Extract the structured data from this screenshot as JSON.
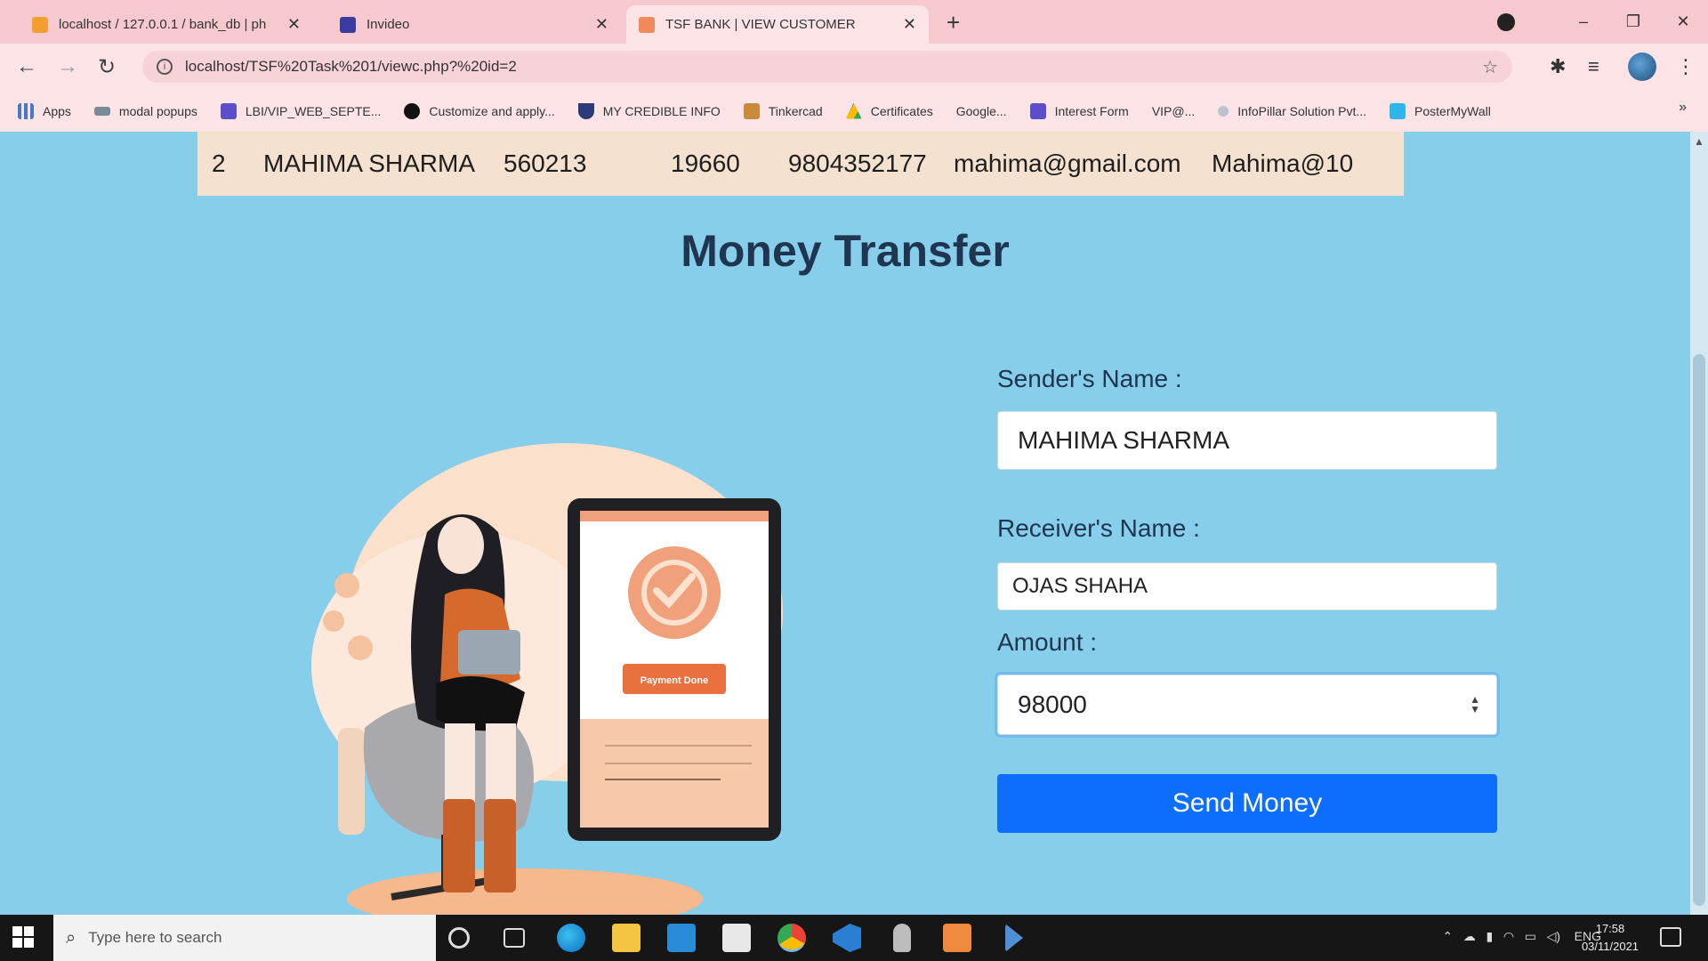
{
  "browser": {
    "tabs": [
      {
        "title": "localhost / 127.0.0.1 / bank_db | ph",
        "active": false
      },
      {
        "title": "Invideo",
        "active": false
      },
      {
        "title": "TSF BANK | VIEW CUSTOMER",
        "active": true
      }
    ],
    "url": "localhost/TSF%20Task%201/viewc.php?%20id=2",
    "bookmarks": [
      "Apps",
      "modal popups",
      "LBI/VIP_WEB_SEPTE...",
      "Customize and apply...",
      "MY CREDIBLE INFO",
      "Tinkercad",
      "Certificates",
      "Google...",
      "Interest Form",
      "VIP@...",
      "InfoPillar Solution Pvt...",
      "PosterMyWall"
    ]
  },
  "customer": {
    "id": "2",
    "name": "MAHIMA SHARMA",
    "account": "560213",
    "balance": "19660",
    "phone": "9804352177",
    "email": "mahima@gmail.com",
    "password": "Mahima@10"
  },
  "page": {
    "title": "Money Transfer",
    "illustration_button": "Payment Done"
  },
  "form": {
    "sender_label": "Sender's Name :",
    "sender_value": "MAHIMA SHARMA",
    "receiver_label": "Receiver's Name :",
    "receiver_value": "OJAS SHAHA",
    "amount_label": "Amount :",
    "amount_value": "98000",
    "submit_label": "Send Money"
  },
  "taskbar": {
    "search_placeholder": "Type here to search",
    "tray_lang": "ENG",
    "time": "17:58",
    "date": "03/11/2021"
  },
  "colors": {
    "page_bg": "#87ceeb",
    "primary_button": "#0d6efd",
    "title_text": "#1f3550",
    "accent_orange": "#f0a07a"
  }
}
